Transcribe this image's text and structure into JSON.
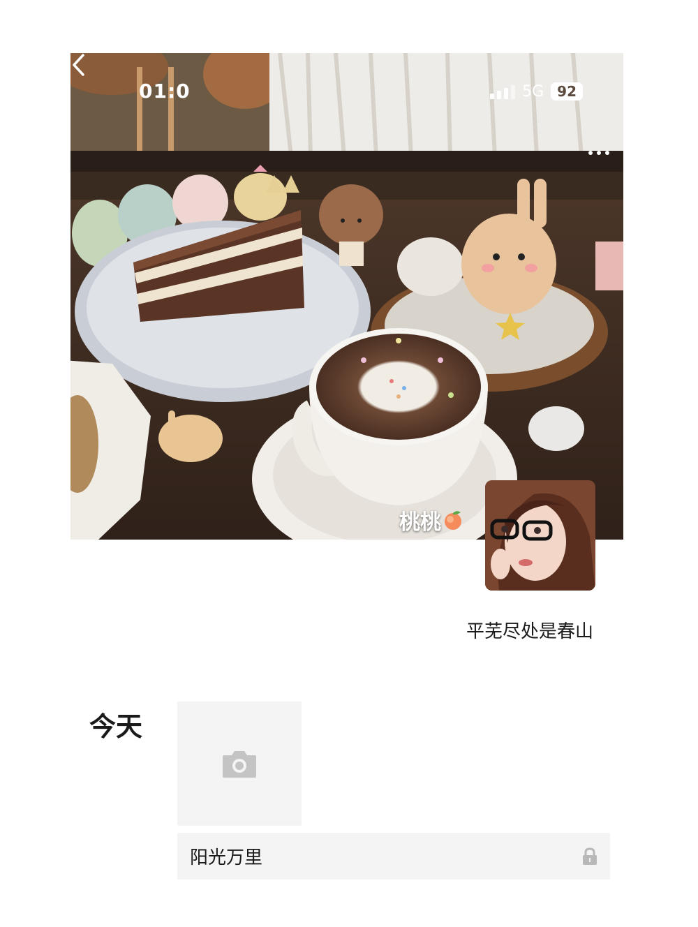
{
  "status_bar": {
    "time": "01:0",
    "network": "5G",
    "battery": "92"
  },
  "profile": {
    "nickname": "桃桃",
    "nickname_emoji": "peach-emoji",
    "signature": "平芜尽处是春山"
  },
  "moments": {
    "date_label": "今天",
    "post_text": "阳光万里",
    "icons": {
      "camera": "camera-icon",
      "lock": "lock-icon",
      "back": "back-arrow-icon",
      "more": "more-dots-icon"
    }
  },
  "colors": {
    "tile_background": "#f4f4f4",
    "text": "#1a1a1a",
    "icon_gray": "#c4c4c4"
  }
}
